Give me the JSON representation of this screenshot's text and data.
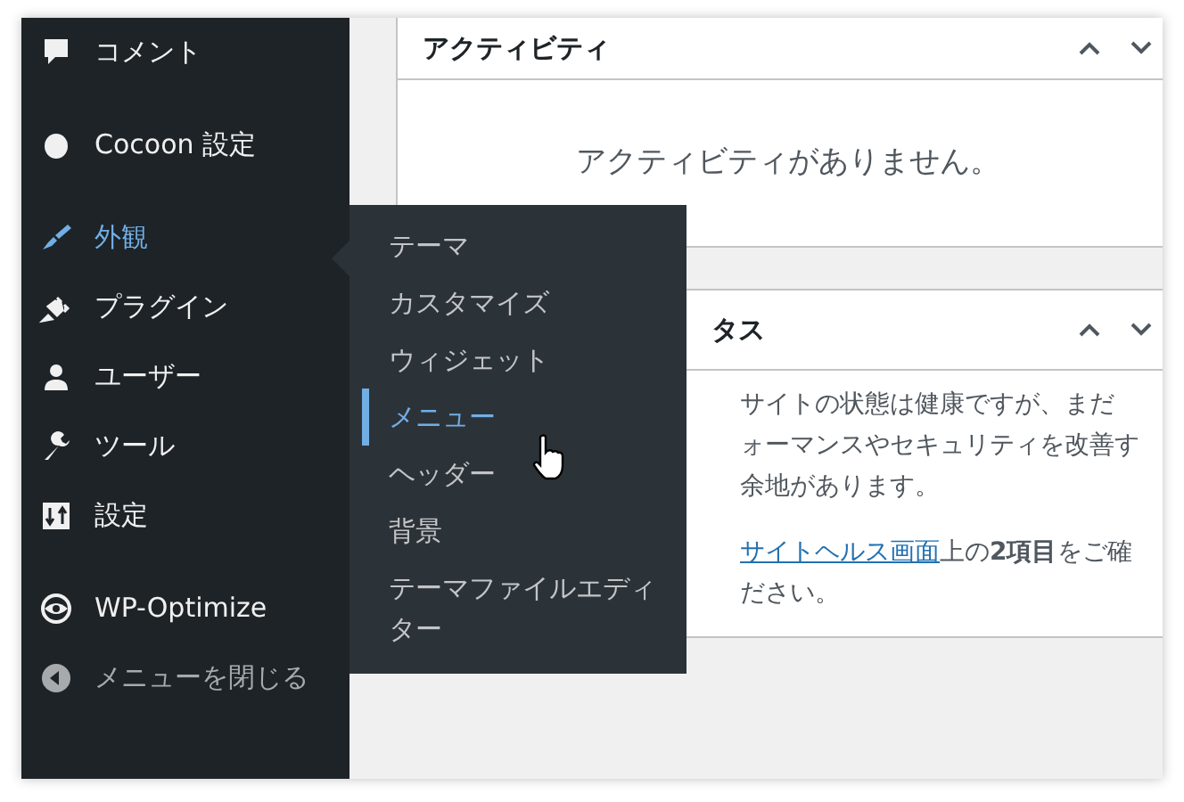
{
  "sidebar": {
    "groups": [
      [
        {
          "label": "コメント",
          "kind": "menu",
          "selected": false
        }
      ],
      [
        {
          "label": "Cocoon 設定",
          "kind": "menu",
          "selected": false
        }
      ],
      [
        {
          "label": "外観",
          "kind": "menu",
          "selected": true
        },
        {
          "label": "プラグイン",
          "kind": "menu",
          "selected": false
        },
        {
          "label": "ユーザー",
          "kind": "menu",
          "selected": false
        },
        {
          "label": "ツール",
          "kind": "menu",
          "selected": false
        },
        {
          "label": "設定",
          "kind": "menu",
          "selected": false
        }
      ],
      [
        {
          "label": "WP-Optimize",
          "kind": "menu",
          "selected": false
        },
        {
          "label": "メニューを閉じる",
          "kind": "collapse",
          "selected": false
        }
      ]
    ]
  },
  "flyout": {
    "items": [
      {
        "label": "テーマ",
        "selected": false
      },
      {
        "label": "カスタマイズ",
        "selected": false
      },
      {
        "label": "ウィジェット",
        "selected": false
      },
      {
        "label": "メニュー",
        "selected": true
      },
      {
        "label": "ヘッダー",
        "selected": false
      },
      {
        "label": "背景",
        "selected": false
      },
      {
        "label": "テーマファイルエディター",
        "selected": false
      }
    ]
  },
  "cards": [
    {
      "kind": "empty",
      "title": "アクティビティ",
      "message": "アクティビティがありません。"
    },
    {
      "kind": "text",
      "title": "タス",
      "lines": [
        "サイトの状態は健康ですが、まだ",
        "ォーマンスやセキュリティを改善す",
        "余地があります。"
      ],
      "link": "サイトヘルス画面",
      "link_after": "上の**2項目**をご確",
      "last_line": "ださい。"
    }
  ]
}
